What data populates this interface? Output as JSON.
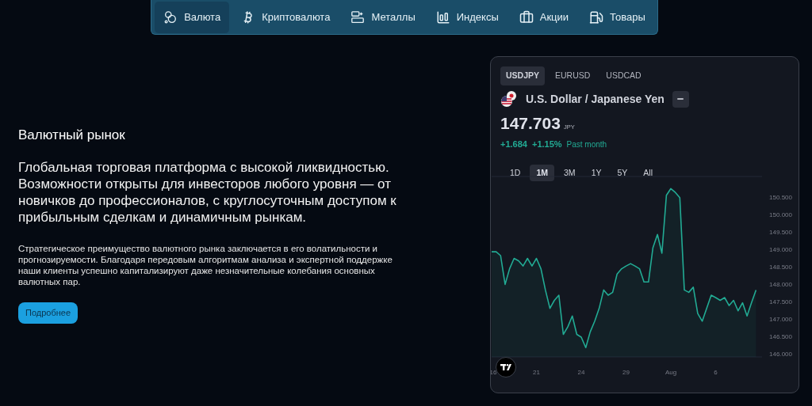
{
  "nav": [
    {
      "label": "Валюта",
      "kind": "circles",
      "selected": true
    },
    {
      "label": "Криптовалюта",
      "kind": "crypto",
      "selected": false
    },
    {
      "label": "Металлы",
      "kind": "bars",
      "selected": false
    },
    {
      "label": "Индексы",
      "kind": "chart",
      "selected": false
    },
    {
      "label": "Акции",
      "kind": "briefcase",
      "selected": false
    },
    {
      "label": "Товары",
      "kind": "fuel",
      "selected": false
    }
  ],
  "hero": {
    "title": "Валютный рынок",
    "lead": "Глобальная торговая платформа с высокой ликвидностью. Возможности открыты для инвесторов любого уровня — от новичков до профессионалов, с круглосуточным доступом к прибыльным сделкам и динамичным рынкам.",
    "body": "Стратегическое преимущество валютного рынка заключается в его волатильности и прогнозируемости. Благодаря передовым алгоритмам анализа и экспертной поддержке наши клиенты успешно капитализируют даже незначительные колебания основных валютных пар.",
    "button": "Подробнее"
  },
  "widget": {
    "symbols": [
      {
        "label": "USDJPY",
        "selected": true
      },
      {
        "label": "EURUSD",
        "selected": false
      },
      {
        "label": "USDCAD",
        "selected": false
      }
    ],
    "name": "U.S. Dollar / Japanese Yen",
    "price": "147.703",
    "currency": "JPY",
    "change": "+1.684",
    "change_pct": "+1.15%",
    "period": "Past month",
    "ranges": [
      {
        "label": "1D",
        "selected": false
      },
      {
        "label": "1M",
        "selected": true
      },
      {
        "label": "3M",
        "selected": false
      },
      {
        "label": "1Y",
        "selected": false
      },
      {
        "label": "5Y",
        "selected": false
      },
      {
        "label": "All",
        "selected": false
      }
    ],
    "chart_data": {
      "type": "area",
      "categories": [
        "16",
        null,
        null,
        null,
        null,
        null,
        null,
        null,
        null,
        null,
        "21",
        null,
        null,
        null,
        null,
        null,
        null,
        null,
        null,
        null,
        "24",
        null,
        null,
        null,
        null,
        null,
        null,
        null,
        null,
        null,
        "29",
        null,
        null,
        null,
        null,
        null,
        null,
        null,
        null,
        null,
        "Aug",
        null,
        null,
        null,
        null,
        null,
        null,
        null,
        null,
        null,
        "6",
        null,
        null,
        null,
        null,
        null,
        null,
        null,
        null,
        null
      ],
      "series": [
        {
          "color": "#22ab94",
          "values": [
            148.93,
            148.93,
            148.82,
            147.99,
            148.44,
            148.74,
            148.67,
            148.52,
            148.74,
            148.52,
            148.74,
            148.44,
            147.83,
            147.3,
            147.53,
            147.68,
            146.55,
            146.77,
            147.08,
            146.55,
            146.47,
            146.17,
            146.62,
            146.93,
            147.3,
            147.83,
            147.68,
            147.76,
            148.29,
            148.44,
            148.52,
            148.59,
            148.52,
            148.44,
            148.06,
            148.06,
            149.05,
            149.43,
            148.89,
            150.56,
            150.75,
            150.64,
            150.49,
            147.83,
            147.76,
            147.91,
            147.15,
            146.93,
            147.3,
            147.68,
            147.61,
            147.53,
            147.61,
            147.38,
            147.53,
            147.23,
            147.46,
            147.08,
            147.46,
            147.83
          ]
        }
      ],
      "ylim": [
        145.9,
        151.1
      ],
      "yticks": [
        {
          "value": 146,
          "label": "146.000"
        },
        {
          "value": 146.5,
          "label": "146.500"
        },
        {
          "value": 147,
          "label": "147.000"
        },
        {
          "value": 147.5,
          "label": "147.500"
        },
        {
          "value": 148,
          "label": "148.000"
        },
        {
          "value": 148.5,
          "label": "148.500"
        },
        {
          "value": 149,
          "label": "149.000"
        },
        {
          "value": 149.5,
          "label": "149.500"
        },
        {
          "value": 150,
          "label": "150.000"
        },
        {
          "value": 150.5,
          "label": "150.500"
        }
      ]
    }
  }
}
